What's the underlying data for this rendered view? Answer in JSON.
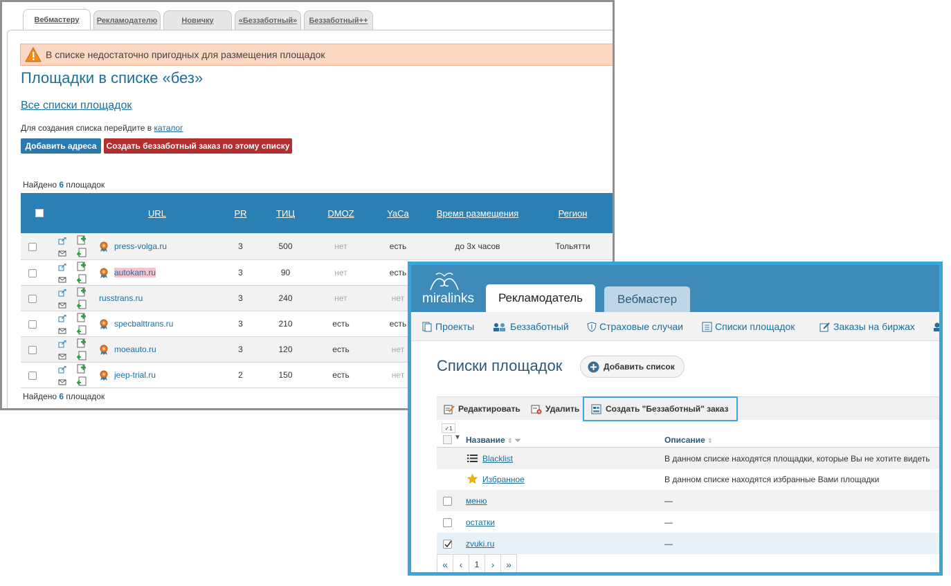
{
  "back": {
    "tabs": [
      "Вебмастеру",
      "Рекламодателю",
      "Новичку",
      "«Беззаботный»",
      "Беззаботный++"
    ],
    "active_tab": "Вебмастеру",
    "alert": "В списке недостаточно пригодных для размещения площадок",
    "title": "Площадки в списке «без»",
    "all_lists_link": "Все списки площадок",
    "create_hint": "Для создания списка перейдите в",
    "create_hint_link": "каталог",
    "btn_add": "Добавить адреса",
    "btn_order": "Создать беззаботный заказ по этому списку",
    "found_prefix": "Найдено",
    "found_count": "6",
    "found_suffix": "площадок",
    "columns": [
      "URL",
      "PR",
      "ТИЦ",
      "DMOZ",
      "YaCa",
      "Время размещения",
      "Регион"
    ],
    "rows": [
      {
        "url": "press-volga.ru",
        "pr": "3",
        "tic": "500",
        "dmoz": "нет",
        "yaca": "есть",
        "time": "до 3х часов",
        "region": "Тольятти",
        "medal": true,
        "highlight": false
      },
      {
        "url": "autokam.ru",
        "pr": "3",
        "tic": "90",
        "dmoz": "нет",
        "yaca": "есть",
        "time": "",
        "region": "",
        "medal": true,
        "highlight": true
      },
      {
        "url": "russtrans.ru",
        "pr": "3",
        "tic": "240",
        "dmoz": "нет",
        "yaca": "нет",
        "time": "",
        "region": "",
        "medal": false,
        "highlight": false
      },
      {
        "url": "specbalttrans.ru",
        "pr": "3",
        "tic": "210",
        "dmoz": "есть",
        "yaca": "есть",
        "time": "",
        "region": "",
        "medal": true,
        "highlight": false
      },
      {
        "url": "moeauto.ru",
        "pr": "3",
        "tic": "120",
        "dmoz": "есть",
        "yaca": "нет",
        "time": "",
        "region": "",
        "medal": true,
        "highlight": false
      },
      {
        "url": "jeep-trial.ru",
        "pr": "2",
        "tic": "150",
        "dmoz": "есть",
        "yaca": "нет",
        "time": "",
        "region": "",
        "medal": true,
        "highlight": false
      }
    ]
  },
  "front": {
    "logo": "miralinks",
    "tab_active": "Рекламодатель",
    "tab_inactive": "Вебмастер",
    "nav": [
      "Проекты",
      "Беззаботный",
      "Страховые случаи",
      "Списки площадок",
      "Заказы на биржах"
    ],
    "title": "Списки площадок",
    "add_list": "Добавить список",
    "toolbar": {
      "edit": "Редактировать",
      "delete": "Удалить",
      "create_order": "Создать \"Беззаботный\" заказ"
    },
    "selected_badge": "1",
    "col_name": "Название",
    "col_desc": "Описание",
    "lists": [
      {
        "name": "Blacklist",
        "desc": "В данном списке находятся площадки, которые Вы не хотите видеть",
        "kind": "blacklist",
        "checked": false
      },
      {
        "name": "Избранное",
        "desc": "В данном списке находятся избранные Вами площадки",
        "kind": "favorite",
        "checked": false
      },
      {
        "name": "меню",
        "desc": "—",
        "kind": "check",
        "checked": false
      },
      {
        "name": "остатки",
        "desc": "—",
        "kind": "check",
        "checked": false
      },
      {
        "name": "zvuki.ru",
        "desc": "—",
        "kind": "check",
        "checked": true
      }
    ],
    "pager": {
      "first": "«",
      "prev": "‹",
      "page": "1",
      "next": "›",
      "last": "»"
    },
    "colors": {
      "accent": "#38a4e0",
      "header": "#3e8ab8",
      "link": "#1b6f9c"
    }
  }
}
